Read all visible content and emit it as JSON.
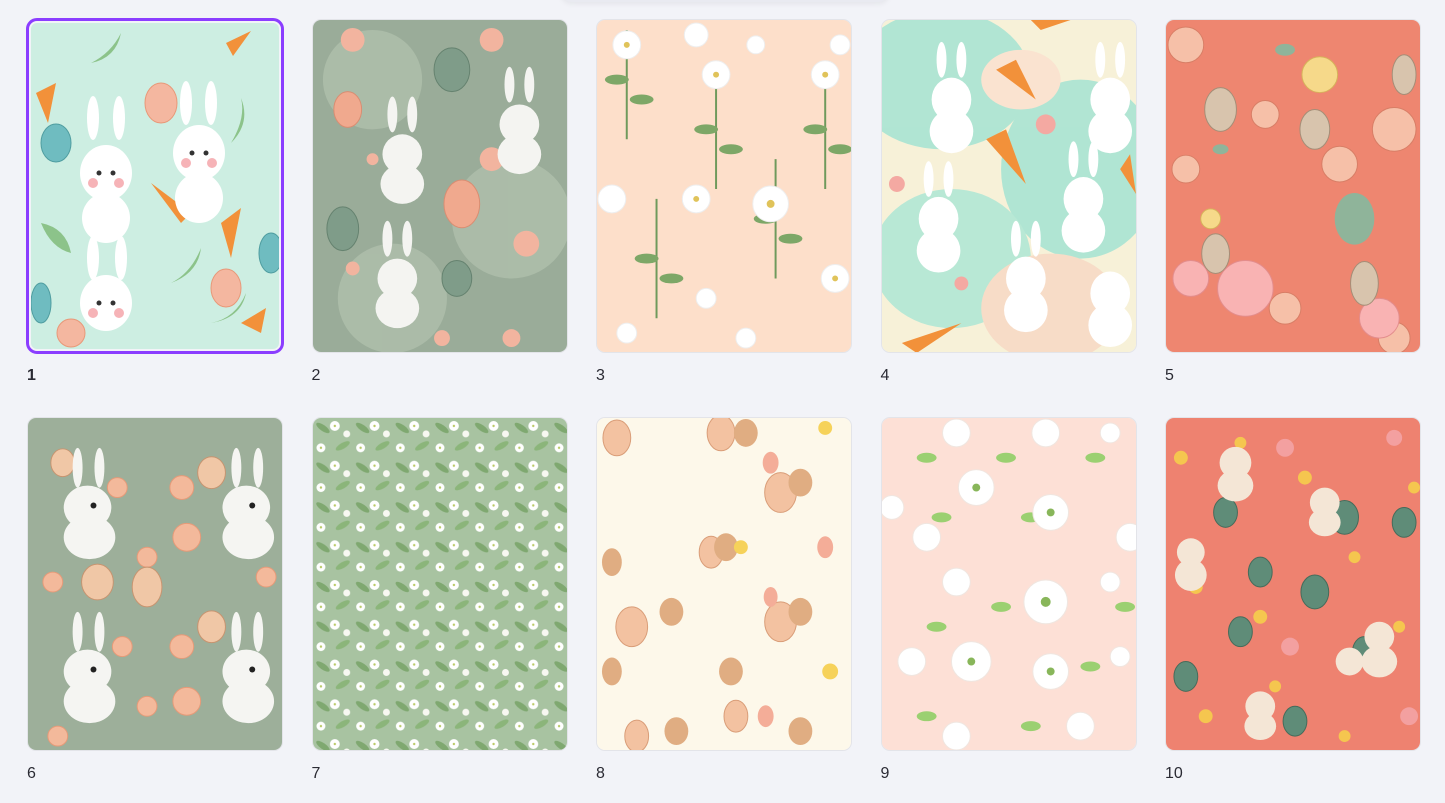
{
  "pages": [
    {
      "number": "1",
      "theme": "bunnies-carrots-mint",
      "bg": "#cfeee2",
      "selected": true
    },
    {
      "number": "2",
      "theme": "bunnies-eggs-sage",
      "bg": "#9fb19e",
      "selected": false
    },
    {
      "number": "3",
      "theme": "white-flowers-peach",
      "bg": "#fde0cc",
      "selected": false
    },
    {
      "number": "4",
      "theme": "bunnies-carrots-watercolor",
      "bg": "#bfeee0",
      "selected": false
    },
    {
      "number": "5",
      "theme": "bunnies-peonies-coral",
      "bg": "#ef8a72",
      "selected": false
    },
    {
      "number": "6",
      "theme": "bunnies-flowers-sage",
      "bg": "#9fb29c",
      "selected": false
    },
    {
      "number": "7",
      "theme": "white-blossoms-green",
      "bg": "#a9c4a3",
      "selected": false
    },
    {
      "number": "8",
      "theme": "bunnies-eggs-tulips-cream",
      "bg": "#fdf8ea",
      "selected": false
    },
    {
      "number": "9",
      "theme": "dogwood-flowers-pink",
      "bg": "#fde0d6",
      "selected": false
    },
    {
      "number": "10",
      "theme": "bunnies-eggs-flowers-coral",
      "bg": "#ef8270",
      "selected": false
    }
  ],
  "colors": {
    "accent": "#8b3dff",
    "page_bg": "#f2f3f8"
  }
}
